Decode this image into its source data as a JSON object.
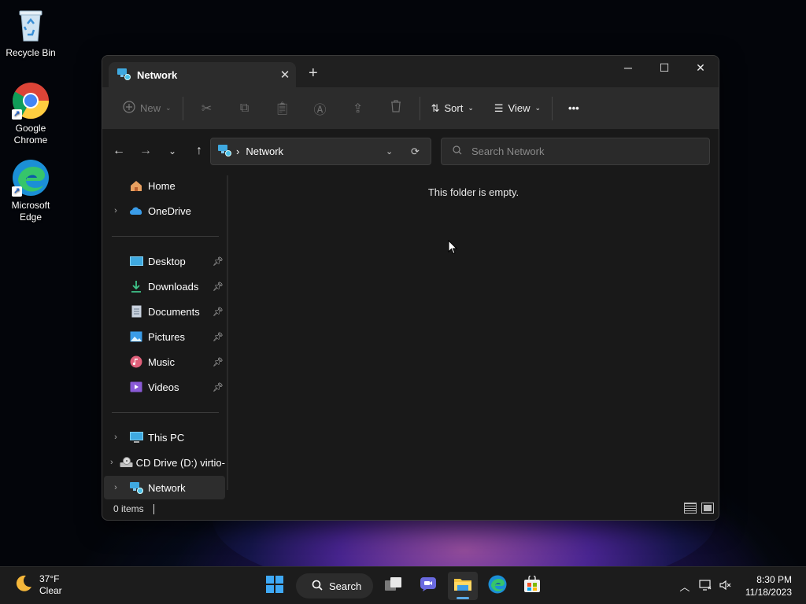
{
  "desktop": {
    "icons": [
      {
        "label": "Recycle Bin",
        "icon": "recycle-bin-icon"
      },
      {
        "label": "Google Chrome",
        "icon": "chrome-icon"
      },
      {
        "label": "Microsoft Edge",
        "icon": "edge-icon"
      }
    ]
  },
  "window": {
    "tab_title": "Network",
    "new_tab": "+",
    "controls": {
      "minimize": "─",
      "maximize": "☐",
      "close": "✕"
    },
    "toolbar": {
      "new_label": "New",
      "sort_label": "Sort",
      "view_label": "View",
      "more_label": "•••"
    },
    "address": {
      "separator": "›",
      "location": "Network"
    },
    "search": {
      "placeholder": "Search Network"
    },
    "sidebar": {
      "items": [
        {
          "label": "Home",
          "icon": "home-icon"
        },
        {
          "label": "OneDrive",
          "icon": "onedrive-icon"
        },
        {
          "label": "Desktop",
          "icon": "desktop-folder-icon",
          "pinned": true
        },
        {
          "label": "Downloads",
          "icon": "downloads-icon",
          "pinned": true
        },
        {
          "label": "Documents",
          "icon": "documents-icon",
          "pinned": true
        },
        {
          "label": "Pictures",
          "icon": "pictures-icon",
          "pinned": true
        },
        {
          "label": "Music",
          "icon": "music-icon",
          "pinned": true
        },
        {
          "label": "Videos",
          "icon": "videos-icon",
          "pinned": true
        },
        {
          "label": "This PC",
          "icon": "this-pc-icon"
        },
        {
          "label": "CD Drive (D:) virtio-",
          "icon": "cd-drive-icon"
        },
        {
          "label": "Network",
          "icon": "network-icon",
          "selected": true
        }
      ]
    },
    "content": {
      "empty_message": "This folder is empty."
    },
    "status": {
      "item_count": "0 items"
    }
  },
  "taskbar": {
    "weather": {
      "temp": "37°F",
      "condition": "Clear"
    },
    "search_label": "Search",
    "clock": {
      "time": "8:30 PM",
      "date": "11/18/2023"
    }
  },
  "colors": {
    "accent": "#5aa9e6",
    "window_bg": "#191919",
    "toolbar_bg": "#2c2c2c",
    "taskbar_bg": "#1c1c1c"
  }
}
